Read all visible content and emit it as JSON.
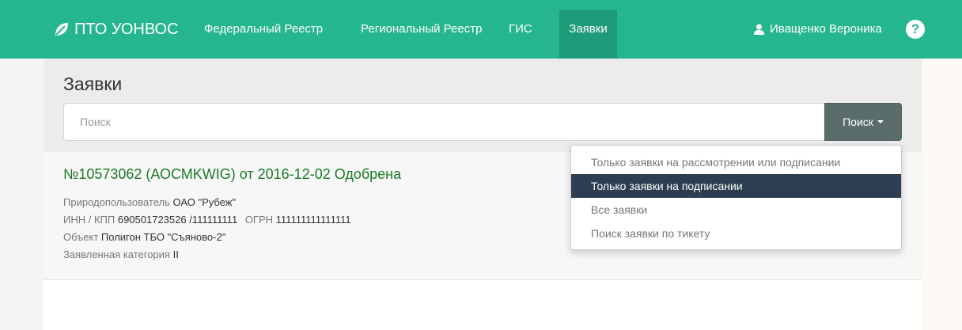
{
  "navbar": {
    "brand": "ПТО УОНВОС",
    "items": [
      "Федеральный Реестр",
      "Региональный Реестр",
      "ГИС"
    ],
    "active_item": "Заявки",
    "user": "Иващенко Вероника",
    "help": "?",
    "color": "#26b68f"
  },
  "page": {
    "title": "Заявки"
  },
  "search": {
    "placeholder": "Поиск",
    "value": "",
    "button_label": "Поиск"
  },
  "dropdown": {
    "items": [
      "Только заявки на рассмотрении или подписании",
      "Только заявки на подписании",
      "Все заявки",
      "Поиск заявки по тикету"
    ],
    "selected": "Только заявки на подписании"
  },
  "result": {
    "title": "№10573062 (АОСМKWIG) от 2016-12-02 Одобрена",
    "user_label": "Природопользователь",
    "user_value": "ОАО \"Рубеж\"",
    "inn_label": "ИНН / КПП",
    "inn_value": "690501723526 /111111111",
    "ogrn_label": "ОГРН",
    "ogrn_value": "111111111111111",
    "object_label": "Объект",
    "object_value": "Полигон ТБО \"Съяново-2\"",
    "category_label": "Заявленная категория",
    "category_value": "II"
  }
}
